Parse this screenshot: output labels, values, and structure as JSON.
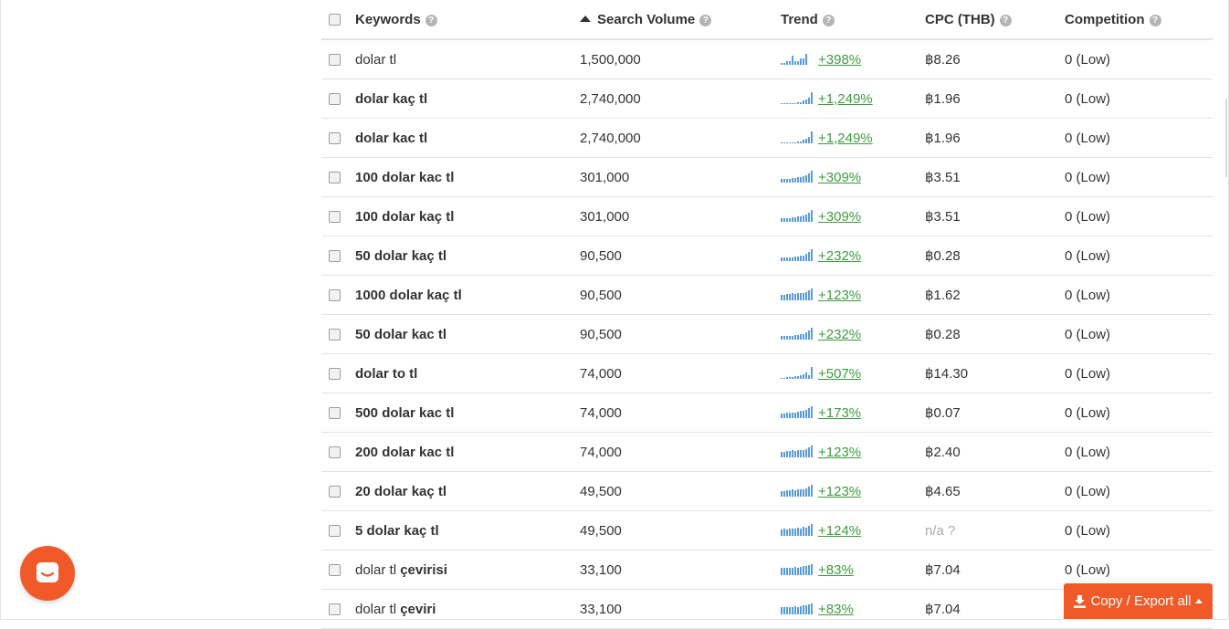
{
  "columns": {
    "keywords": "Keywords",
    "search_volume": "Search Volume",
    "trend": "Trend",
    "cpc": "CPC (THB)",
    "competition": "Competition"
  },
  "rows": [
    {
      "kw_plain": "dolar tl",
      "kw_bold": "",
      "volume": "1,500,000",
      "trend": "+398%",
      "spark": [
        0.15,
        0.15,
        0.25,
        0.3,
        0.7,
        0.3,
        0.25,
        0.5,
        0.5,
        0.85
      ],
      "cpc": "฿8.26",
      "cpc_na": false,
      "competition": "0 (Low)"
    },
    {
      "kw_plain": "",
      "kw_bold": "dolar kaç tl",
      "volume": "2,740,000",
      "trend": "+1,249%",
      "spark": [
        0.08,
        0.08,
        0.08,
        0.08,
        0.1,
        0.1,
        0.12,
        0.15,
        0.25,
        0.35,
        0.5,
        0.9
      ],
      "cpc": "฿1.96",
      "cpc_na": false,
      "competition": "0 (Low)"
    },
    {
      "kw_plain": "",
      "kw_bold": "dolar kac tl",
      "volume": "2,740,000",
      "trend": "+1,249%",
      "spark": [
        0.08,
        0.08,
        0.08,
        0.08,
        0.1,
        0.1,
        0.12,
        0.15,
        0.25,
        0.35,
        0.5,
        0.9
      ],
      "cpc": "฿1.96",
      "cpc_na": false,
      "competition": "0 (Low)"
    },
    {
      "kw_plain": "",
      "kw_bold": "100 dolar kac tl",
      "volume": "301,000",
      "trend": "+309%",
      "spark": [
        0.25,
        0.25,
        0.3,
        0.3,
        0.35,
        0.35,
        0.45,
        0.4,
        0.5,
        0.55,
        0.7,
        0.9
      ],
      "cpc": "฿3.51",
      "cpc_na": false,
      "competition": "0 (Low)"
    },
    {
      "kw_plain": "",
      "kw_bold": "100 dolar kaç tl",
      "volume": "301,000",
      "trend": "+309%",
      "spark": [
        0.25,
        0.25,
        0.3,
        0.3,
        0.35,
        0.35,
        0.45,
        0.4,
        0.5,
        0.55,
        0.7,
        0.9
      ],
      "cpc": "฿3.51",
      "cpc_na": false,
      "competition": "0 (Low)"
    },
    {
      "kw_plain": "",
      "kw_bold": "50 dolar kaç tl",
      "volume": "90,500",
      "trend": "+232%",
      "spark": [
        0.25,
        0.25,
        0.3,
        0.3,
        0.3,
        0.35,
        0.35,
        0.4,
        0.45,
        0.55,
        0.7,
        0.95
      ],
      "cpc": "฿0.28",
      "cpc_na": false,
      "competition": "0 (Low)"
    },
    {
      "kw_plain": "",
      "kw_bold": "1000 dolar kaç tl",
      "volume": "90,500",
      "trend": "+123%",
      "spark": [
        0.45,
        0.45,
        0.5,
        0.5,
        0.55,
        0.5,
        0.55,
        0.6,
        0.6,
        0.65,
        0.75,
        0.95
      ],
      "cpc": "฿1.62",
      "cpc_na": false,
      "competition": "0 (Low)"
    },
    {
      "kw_plain": "",
      "kw_bold": "50 dolar kac tl",
      "volume": "90,500",
      "trend": "+232%",
      "spark": [
        0.25,
        0.25,
        0.3,
        0.3,
        0.3,
        0.35,
        0.35,
        0.4,
        0.45,
        0.55,
        0.7,
        0.95
      ],
      "cpc": "฿0.28",
      "cpc_na": false,
      "competition": "0 (Low)"
    },
    {
      "kw_plain": "",
      "kw_bold": "dolar to tl",
      "volume": "74,000",
      "trend": "+507%",
      "spark": [
        0.1,
        0.1,
        0.12,
        0.15,
        0.15,
        0.2,
        0.2,
        0.3,
        0.35,
        0.5,
        0.3,
        0.9
      ],
      "cpc": "฿14.30",
      "cpc_na": false,
      "competition": "0 (Low)"
    },
    {
      "kw_plain": "",
      "kw_bold": "500 dolar kac tl",
      "volume": "74,000",
      "trend": "+173%",
      "spark": [
        0.35,
        0.35,
        0.4,
        0.4,
        0.45,
        0.45,
        0.5,
        0.55,
        0.6,
        0.65,
        0.75,
        0.95
      ],
      "cpc": "฿0.07",
      "cpc_na": false,
      "competition": "0 (Low)"
    },
    {
      "kw_plain": "",
      "kw_bold": "200 dolar kac tl",
      "volume": "74,000",
      "trend": "+123%",
      "spark": [
        0.45,
        0.45,
        0.5,
        0.5,
        0.55,
        0.5,
        0.55,
        0.6,
        0.6,
        0.65,
        0.75,
        0.95
      ],
      "cpc": "฿2.40",
      "cpc_na": false,
      "competition": "0 (Low)"
    },
    {
      "kw_plain": "",
      "kw_bold": "20 dolar kaç tl",
      "volume": "49,500",
      "trend": "+123%",
      "spark": [
        0.45,
        0.45,
        0.5,
        0.5,
        0.55,
        0.5,
        0.55,
        0.6,
        0.6,
        0.65,
        0.75,
        0.95
      ],
      "cpc": "฿4.65",
      "cpc_na": false,
      "competition": "0 (Low)"
    },
    {
      "kw_plain": "",
      "kw_bold": "5 dolar kaç tl",
      "volume": "49,500",
      "trend": "+124%",
      "spark": [
        0.5,
        0.55,
        0.5,
        0.6,
        0.55,
        0.6,
        0.65,
        0.6,
        0.7,
        0.65,
        0.75,
        0.95
      ],
      "cpc": "n/a ?",
      "cpc_na": true,
      "competition": "0 (Low)"
    },
    {
      "kw_plain": "dolar tl ",
      "kw_bold": "çevirisi",
      "volume": "33,100",
      "trend": "+83%",
      "spark": [
        0.55,
        0.6,
        0.55,
        0.6,
        0.6,
        0.65,
        0.6,
        0.65,
        0.7,
        0.7,
        0.75,
        0.85
      ],
      "cpc": "฿7.04",
      "cpc_na": false,
      "competition": "0 (Low)"
    },
    {
      "kw_plain": "dolar tl ",
      "kw_bold": "çeviri",
      "volume": "33,100",
      "trend": "+83%",
      "spark": [
        0.55,
        0.6,
        0.55,
        0.6,
        0.6,
        0.65,
        0.6,
        0.65,
        0.7,
        0.7,
        0.75,
        0.85
      ],
      "cpc": "฿7.04",
      "cpc_na": false,
      "competition": "0 (Low)"
    }
  ],
  "export_button": "Copy / Export all",
  "help_glyph": "?",
  "colors": {
    "accent": "#f05a28",
    "trend_up": "#3f9b3f",
    "sparkline": "#5b9bdc"
  },
  "icons": {
    "chat": "chat-bubble-icon",
    "export": "download-icon",
    "help": "help-circle-icon"
  }
}
